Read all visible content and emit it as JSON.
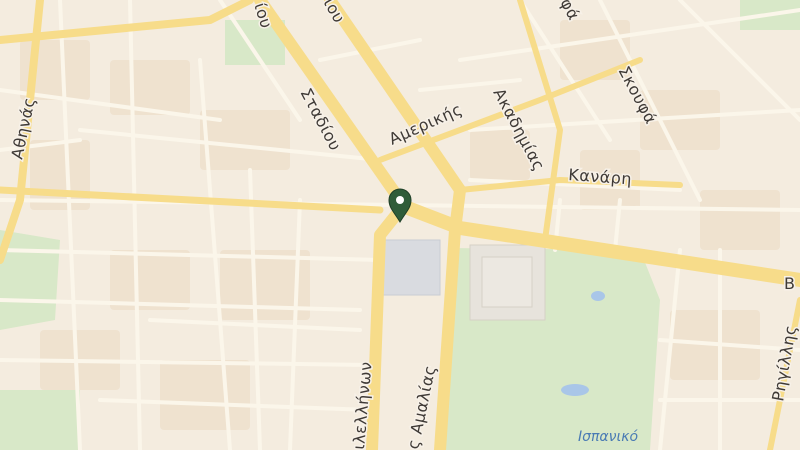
{
  "map": {
    "colors": {
      "land": "#f4ecdf",
      "block": "#efe2cf",
      "park": "#d8e8c8",
      "park_dark": "#cfe1bd",
      "major_road": "#f7dc8a",
      "minor_road": "#fbf6ea",
      "square": "#d9dbe0",
      "marker": "#2f5d3a"
    },
    "streets": {
      "athinas": "Αθηνάς",
      "stadiou": "Σταδίου",
      "stadiou_top": "ίου",
      "stadiou_top2": "ιου",
      "amerikis": "Αμερικής",
      "akadimias": "Ακαδημίας",
      "skoufa": "Σκουφά",
      "skoufa_top": "φά",
      "kanari": "Κανάρη",
      "filellinon": "ιλελλήνων",
      "amalias": "ς Αμαλίας",
      "rigillis": "Ρηγίλλης",
      "edge_b": "B"
    },
    "places": {
      "ispaniko": "Ισπανικό"
    },
    "marker": {
      "icon": "map-pin-icon"
    }
  }
}
